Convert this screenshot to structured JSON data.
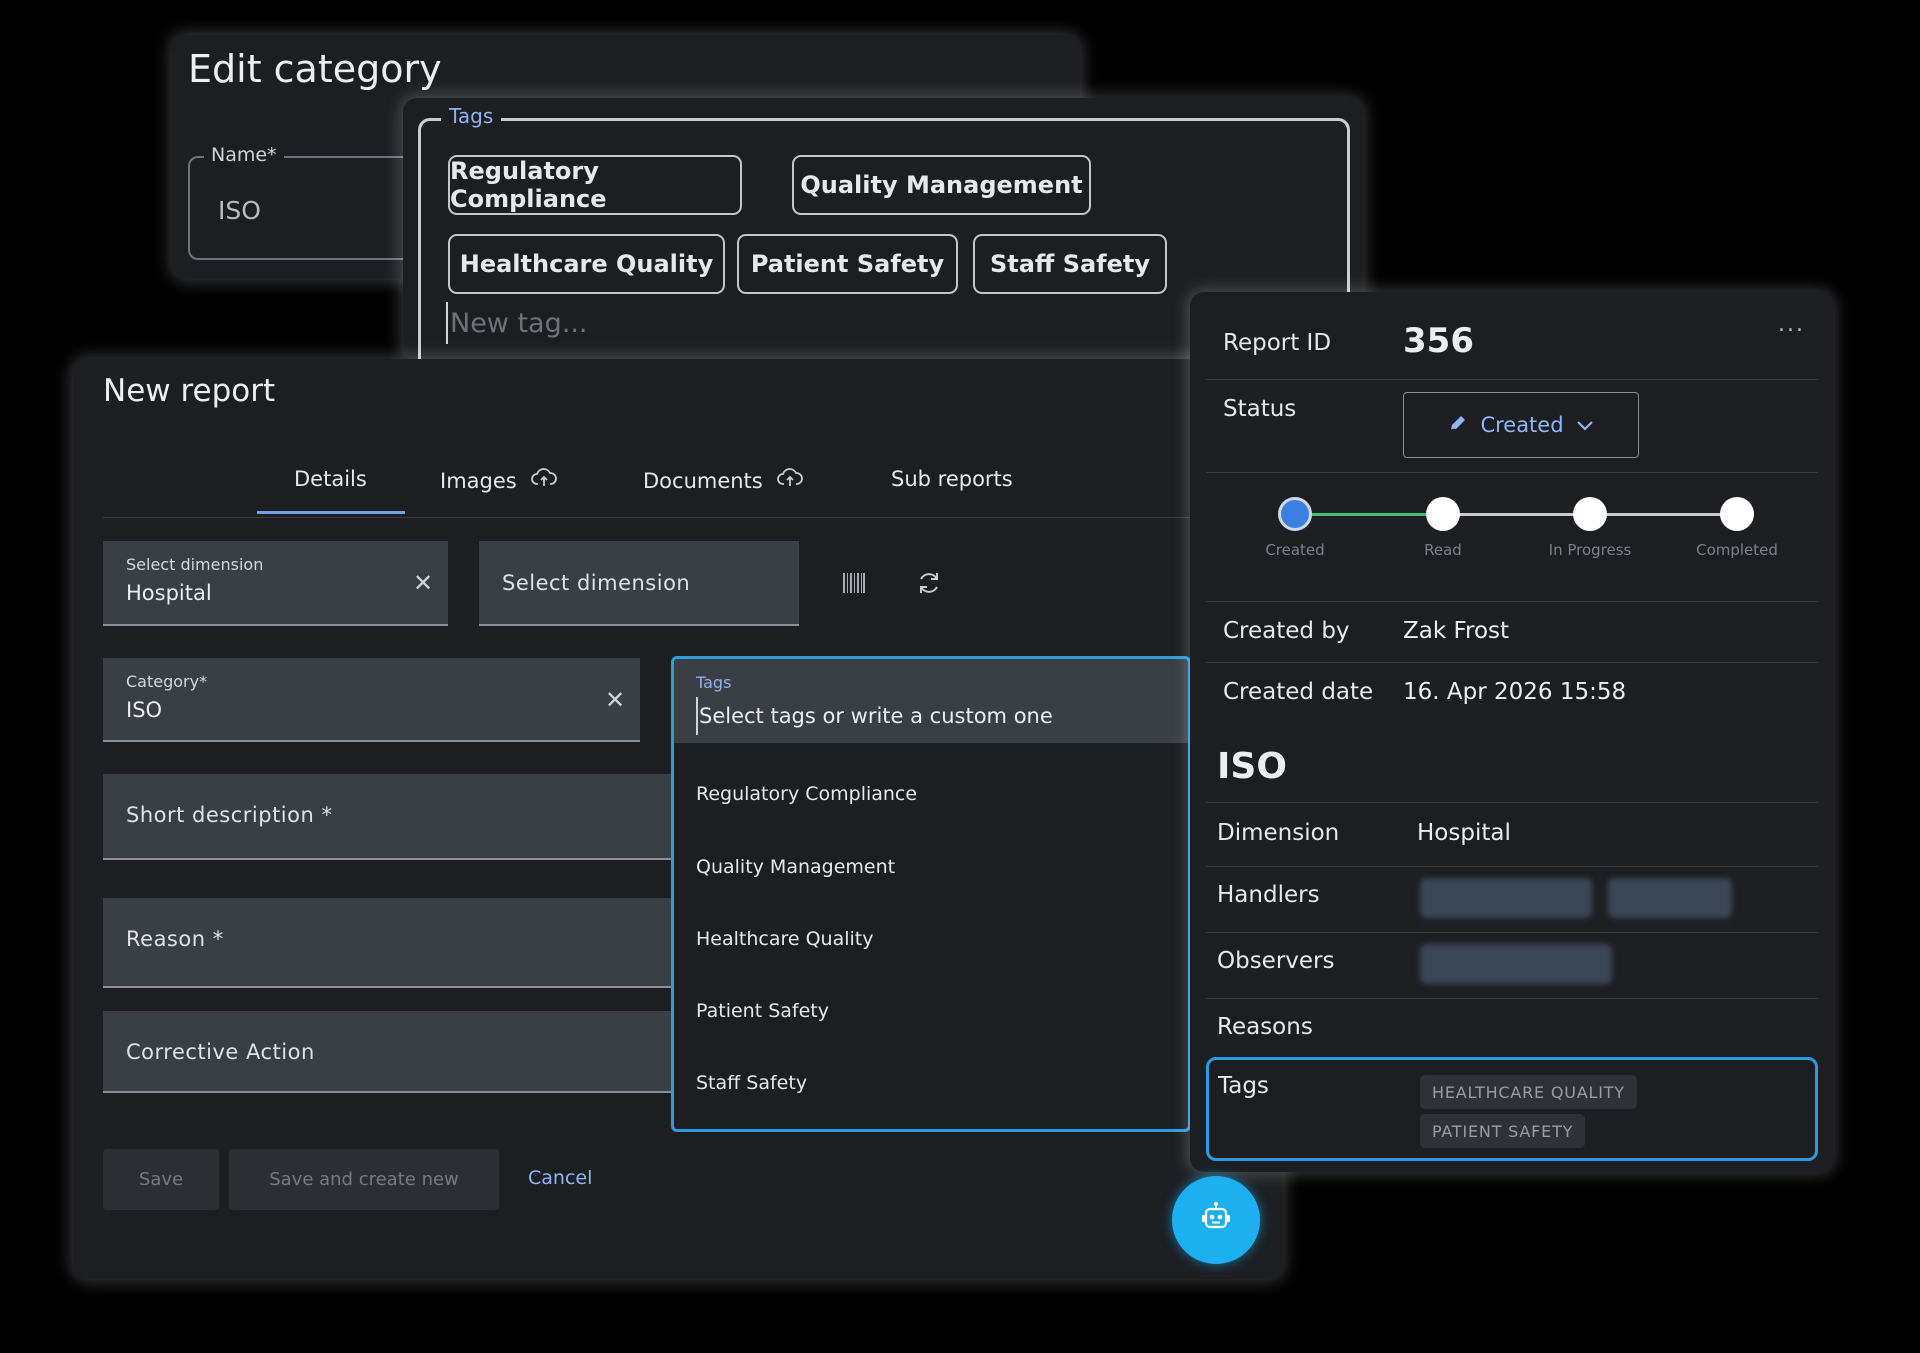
{
  "edit_category": {
    "title": "Edit category",
    "name_label": "Name*",
    "name_value": "ISO"
  },
  "tags_editor": {
    "legend": "Tags",
    "chips": [
      "Regulatory Compliance",
      "Quality Management",
      "Healthcare Quality",
      "Patient Safety",
      "Staff Safety"
    ],
    "new_tag_placeholder": "New tag..."
  },
  "new_report": {
    "title": "New report",
    "tabs": [
      {
        "label": "Details",
        "icon": ""
      },
      {
        "label": "Images",
        "icon": "cloud-upload-icon"
      },
      {
        "label": "Documents",
        "icon": "cloud-upload-icon"
      },
      {
        "label": "Sub reports",
        "icon": ""
      }
    ],
    "active_tab": "Details",
    "dimension_field": {
      "label": "Select dimension",
      "value": "Hospital"
    },
    "dimension_placeholder": "Select dimension",
    "category_field": {
      "label": "Category*",
      "value": "ISO"
    },
    "short_description_placeholder": "Short description *",
    "reason_placeholder": "Reason *",
    "corrective_action_placeholder": "Corrective Action",
    "buttons": {
      "save": "Save",
      "save_new": "Save and create new",
      "cancel": "Cancel"
    }
  },
  "tags_dropdown": {
    "label": "Tags",
    "placeholder": "Select tags or write a custom one",
    "options": [
      "Regulatory Compliance",
      "Quality Management",
      "Healthcare Quality",
      "Patient Safety",
      "Staff Safety"
    ]
  },
  "report_detail": {
    "report_id_label": "Report ID",
    "report_id": "356",
    "more_label": "...",
    "status_label": "Status",
    "status_value": "Created",
    "steps": [
      "Created",
      "Read",
      "In Progress",
      "Completed"
    ],
    "current_step": 0,
    "created_by_label": "Created by",
    "created_by": "Zak Frost",
    "created_date_label": "Created date",
    "created_date": "16. Apr 2026 15:58",
    "category": "ISO",
    "dimension_label": "Dimension",
    "dimension": "Hospital",
    "handlers_label": "Handlers",
    "observers_label": "Observers",
    "reasons_label": "Reasons",
    "tags_label": "Tags",
    "tags": [
      "HEALTHCARE QUALITY",
      "PATIENT SAFETY"
    ]
  },
  "colors": {
    "accent_blue": "#2c9be0",
    "link_blue": "#8fb6f5",
    "progress_green": "#3ec07a",
    "step_active": "#3b7fe0",
    "fab": "#1cb0f0"
  }
}
